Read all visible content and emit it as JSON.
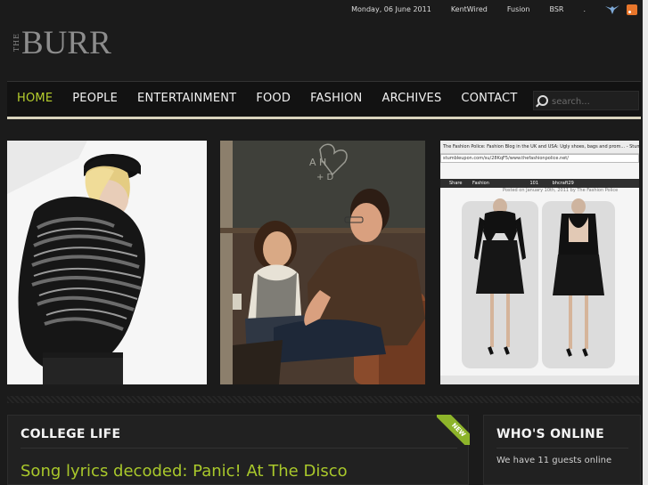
{
  "topbar": {
    "date": "Monday, 06 June 2011",
    "links": [
      "KentWired",
      "Fusion",
      "BSR",
      "."
    ]
  },
  "logo": {
    "small": "THE",
    "main": "BURR"
  },
  "nav": {
    "items": [
      "HOME",
      "PEOPLE",
      "ENTERTAINMENT",
      "FOOD",
      "FASHION",
      "ARCHIVES",
      "CONTACT"
    ],
    "active": "HOME",
    "search_placeholder": "search..."
  },
  "photos": {
    "fashion_screenshot": {
      "title": "The Fashion Police: Fashion Blog in the UK and USA: Ugly shoes, bags and prom... - Stum",
      "url": "stumbleupon.com/su/28KqF5/www.thefashionpolice.net/",
      "share": "Share",
      "section": "Fashion",
      "count": "101",
      "user": "bhcraft29",
      "caption": "Posted on January 10th, 2011 by The Fashion Police"
    }
  },
  "college_life": {
    "title": "COLLEGE LIFE",
    "badge": "NEW",
    "headline": "Song lyrics decoded: Panic! At The Disco"
  },
  "whos_online": {
    "title": "WHO'S ONLINE",
    "text": "We have 11 guests online"
  },
  "colors": {
    "accent": "#a9c82b",
    "background": "#1b1b1b",
    "nav_underline": "#d8d3bd"
  }
}
